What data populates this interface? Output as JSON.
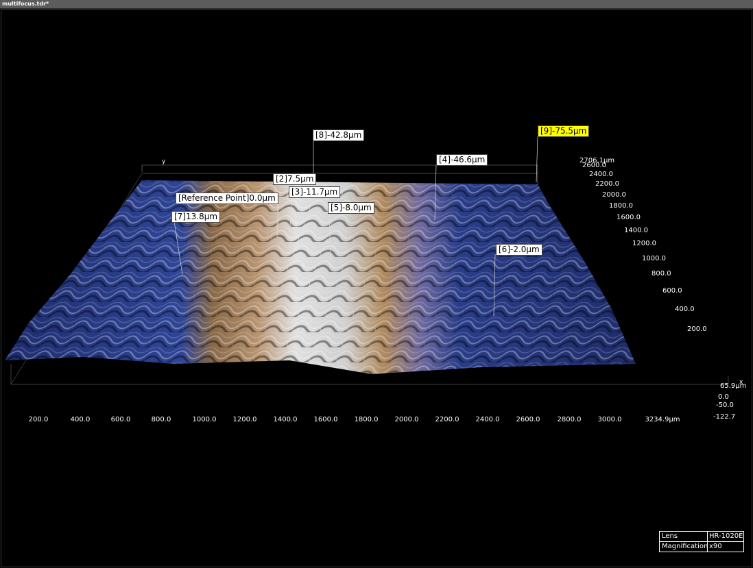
{
  "window": {
    "title": "multifocus.tdr*"
  },
  "axes": {
    "x_label": "x",
    "y_label": "y",
    "x_ticks": [
      "200.0",
      "400.0",
      "600.0",
      "800.0",
      "1000.0",
      "1200.0",
      "1400.0",
      "1600.0",
      "1800.0",
      "2000.0",
      "2200.0",
      "2400.0",
      "2600.0",
      "2800.0",
      "3000.0",
      "3234.9µm"
    ],
    "y_ticks": [
      "2706.1µm",
      "2600.0",
      "2400.0",
      "2200.0",
      "2000.0",
      "1800.0",
      "1600.0",
      "1400.0",
      "1200.0",
      "1000.0",
      "800.0",
      "600.0",
      "400.0",
      "200.0"
    ],
    "z_ticks": [
      "65.9µm",
      "0.0",
      "-50.0",
      "-122.7"
    ]
  },
  "markers": [
    {
      "id": "8",
      "label": "[8]-42.8µm"
    },
    {
      "id": "9",
      "label": "[9]-75.5µm",
      "highlighted": true
    },
    {
      "id": "4",
      "label": "[4]-46.6µm"
    },
    {
      "id": "2",
      "label": "[2]7.5µm"
    },
    {
      "id": "3",
      "label": "[3]-11.7µm"
    },
    {
      "id": "ref",
      "label": "[Reference Point]0.0µm"
    },
    {
      "id": "5",
      "label": "[5]-8.0µm"
    },
    {
      "id": "7",
      "label": "[7]13.8µm"
    },
    {
      "id": "6",
      "label": "[6]-2.0µm"
    }
  ],
  "info": {
    "lens_label": "Lens",
    "lens_value": "HR-1020E",
    "mag_label": "Magnification",
    "mag_value": "x90"
  },
  "colors": {
    "blue_fabric": "#2b3f8a",
    "tan_fabric": "#b08a5e",
    "white_fabric": "#d8d8d8"
  }
}
